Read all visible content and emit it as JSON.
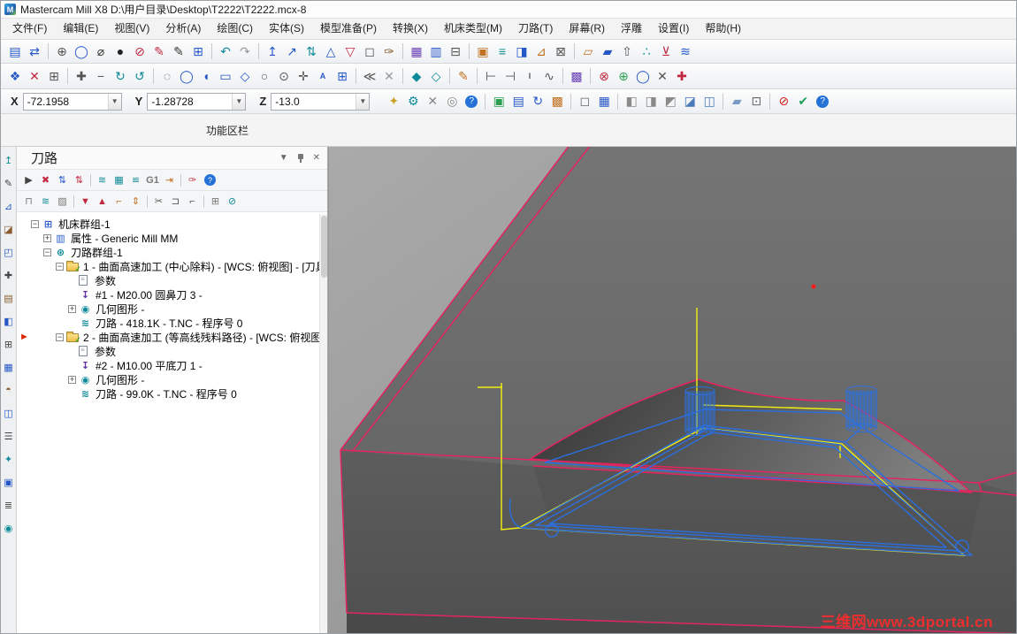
{
  "window": {
    "title": "Mastercam Mill X8  D:\\用户目录\\Desktop\\T2222\\T2222.mcx-8"
  },
  "menu": {
    "items": [
      "文件(F)",
      "编辑(E)",
      "视图(V)",
      "分析(A)",
      "绘图(C)",
      "实体(S)",
      "模型准备(P)",
      "转换(X)",
      "机床类型(M)",
      "刀路(T)",
      "屏幕(R)",
      "浮雕",
      "设置(I)",
      "帮助(H)"
    ]
  },
  "toolbars": {
    "row1": [
      {
        "g": "▤",
        "c": "#2557c7",
        "n": "save-icon"
      },
      {
        "g": "⇄",
        "c": "#2557c7",
        "n": "file-transfer-icon"
      },
      {
        "sep": true
      },
      {
        "g": "⊕",
        "c": "#555555"
      },
      {
        "g": "◯",
        "c": "#2557c7"
      },
      {
        "g": "⌀",
        "c": "#333333"
      },
      {
        "g": "●",
        "c": "#222222"
      },
      {
        "g": "⊘",
        "c": "#c22840"
      },
      {
        "g": "✎",
        "c": "#c22840"
      },
      {
        "g": "✎",
        "c": "#333333"
      },
      {
        "g": "⊞",
        "c": "#2557c7"
      },
      {
        "sep": true
      },
      {
        "g": "↶",
        "c": "#0f8a9a",
        "n": "undo-icon"
      },
      {
        "g": "↷",
        "c": "#999999",
        "n": "redo-icon"
      },
      {
        "sep": true
      },
      {
        "g": "↥",
        "c": "#2557c7"
      },
      {
        "g": "↗",
        "c": "#2557c7"
      },
      {
        "g": "⇅",
        "c": "#0f8a9a"
      },
      {
        "g": "△",
        "c": "#2557c7"
      },
      {
        "g": "▽",
        "c": "#c22840"
      },
      {
        "g": "◻",
        "c": "#555555"
      },
      {
        "g": "✑",
        "c": "#8a5a2b"
      },
      {
        "sep": true
      },
      {
        "g": "▦",
        "c": "#6a3fb5"
      },
      {
        "g": "▥",
        "c": "#2557c7"
      },
      {
        "g": "⊟",
        "c": "#555555"
      },
      {
        "sep": true
      },
      {
        "g": "▣",
        "c": "#c07020"
      },
      {
        "g": "≡",
        "c": "#0f8a9a"
      },
      {
        "g": "◨",
        "c": "#2557c7"
      },
      {
        "g": "⊿",
        "c": "#c07020"
      },
      {
        "g": "⊠",
        "c": "#555555"
      },
      {
        "sep": true
      },
      {
        "g": "▱",
        "c": "#c07020"
      },
      {
        "g": "▰",
        "c": "#2557c7"
      },
      {
        "g": "⇧",
        "c": "#555555"
      },
      {
        "g": "∴",
        "c": "#0f8a9a"
      },
      {
        "g": "⊻",
        "c": "#c22840"
      },
      {
        "g": "≋",
        "c": "#2557c7"
      }
    ],
    "row2": [
      {
        "g": "❖",
        "c": "#2557c7"
      },
      {
        "g": "✕",
        "c": "#c22840"
      },
      {
        "g": "⊞",
        "c": "#555555"
      },
      {
        "sep": true
      },
      {
        "g": "✚",
        "c": "#555555"
      },
      {
        "g": "−",
        "c": "#555555"
      },
      {
        "g": "↻",
        "c": "#0f8a9a"
      },
      {
        "g": "↺",
        "c": "#0f8a9a"
      },
      {
        "sep": true
      },
      {
        "g": "◌",
        "c": "#555555"
      },
      {
        "g": "◯",
        "c": "#2557c7"
      },
      {
        "g": "◖",
        "c": "#2557c7"
      },
      {
        "g": "▭",
        "c": "#2557c7"
      },
      {
        "g": "◇",
        "c": "#2557c7"
      },
      {
        "g": "○",
        "c": "#555555"
      },
      {
        "g": "⊙",
        "c": "#555555"
      },
      {
        "g": "✛",
        "c": "#555555"
      },
      {
        "g": "A",
        "c": "#2557c7",
        "text": true
      },
      {
        "g": "⊞",
        "c": "#2557c7"
      },
      {
        "sep": true
      },
      {
        "g": "≪",
        "c": "#555555"
      },
      {
        "g": "✕",
        "c": "#999999"
      },
      {
        "sep": true
      },
      {
        "g": "◆",
        "c": "#0f8a9a"
      },
      {
        "g": "◇",
        "c": "#0f8a9a"
      },
      {
        "sep": true
      },
      {
        "g": "✎",
        "c": "#c07020"
      },
      {
        "sep": true
      },
      {
        "g": "⊢",
        "c": "#555555"
      },
      {
        "g": "⊣",
        "c": "#555555"
      },
      {
        "g": "I",
        "c": "#555555",
        "text": true
      },
      {
        "g": "∿",
        "c": "#555555"
      },
      {
        "sep": true
      },
      {
        "g": "▩",
        "c": "#6a3fb5"
      },
      {
        "sep": true
      },
      {
        "g": "⊗",
        "c": "#c22840"
      },
      {
        "g": "⊕",
        "c": "#2e9e4f"
      },
      {
        "g": "◯",
        "c": "#2557c7"
      },
      {
        "g": "✕",
        "c": "#555555"
      },
      {
        "g": "✚",
        "c": "#c22840"
      }
    ],
    "row3": [
      {
        "g": "✦",
        "c": "#c9a227"
      },
      {
        "g": "⚙",
        "c": "#0f8a9a",
        "n": "gear-icon"
      },
      {
        "g": "✕",
        "c": "#888888"
      },
      {
        "g": "◎",
        "c": "#888888"
      },
      {
        "help": true,
        "g": "?",
        "n": "help-icon"
      },
      {
        "sep": true
      },
      {
        "g": "▣",
        "c": "#2e9e4f"
      },
      {
        "g": "▤",
        "c": "#2557c7"
      },
      {
        "g": "↻",
        "c": "#2557c7"
      },
      {
        "g": "▩",
        "c": "#c07020"
      },
      {
        "sep": true
      },
      {
        "g": "◻",
        "c": "#666666"
      },
      {
        "g": "▦",
        "c": "#2557c7"
      },
      {
        "sep": true
      },
      {
        "g": "◧",
        "c": "#8a8a8a",
        "n": "shading-cube-icon"
      },
      {
        "g": "◨",
        "c": "#8a8a8a",
        "n": "shading-cube-icon"
      },
      {
        "g": "◩",
        "c": "#8a8a8a",
        "n": "shading-cube-icon"
      },
      {
        "g": "◪",
        "c": "#4a7ab8",
        "n": "shading-cube-icon"
      },
      {
        "g": "◫",
        "c": "#4a7ab8",
        "n": "shading-cube-icon"
      },
      {
        "sep": true
      },
      {
        "g": "▰",
        "c": "#7a9cc4"
      },
      {
        "g": "⊡",
        "c": "#666666"
      },
      {
        "sep": true
      },
      {
        "g": "⊘",
        "c": "#d42020",
        "n": "stop-icon"
      },
      {
        "g": "✔",
        "c": "#1fa05a",
        "n": "check-icon"
      },
      {
        "help": true,
        "g": "?",
        "n": "help-icon"
      }
    ],
    "left_strip": [
      {
        "g": "↥",
        "c": "#0f8a9a"
      },
      {
        "g": "✎",
        "c": "#444444"
      },
      {
        "g": "⊿",
        "c": "#2557c7"
      },
      {
        "g": "◪",
        "c": "#8a5a2b"
      },
      {
        "g": "◰",
        "c": "#2557c7"
      },
      {
        "g": "✚",
        "c": "#444444"
      },
      {
        "g": "▤",
        "c": "#8a5a2b"
      },
      {
        "g": "◧",
        "c": "#2557c7"
      },
      {
        "g": "⊞",
        "c": "#444444"
      },
      {
        "g": "▦",
        "c": "#2557c7"
      },
      {
        "g": "◓",
        "c": "#8a5a2b"
      },
      {
        "g": "◫",
        "c": "#2557c7"
      },
      {
        "g": "☰",
        "c": "#444444"
      },
      {
        "g": "✦",
        "c": "#0f8a9a"
      },
      {
        "g": "▣",
        "c": "#2557c7"
      },
      {
        "g": "≣",
        "c": "#444444"
      },
      {
        "g": "◉",
        "c": "#0f8a9a"
      }
    ]
  },
  "coords": {
    "x_label": "X",
    "x_value": "-72.1958",
    "y_label": "Y",
    "y_value": "-1.28728",
    "z_label": "Z",
    "z_value": "-13.0"
  },
  "ribbon": {
    "label": "功能区栏"
  },
  "panel": {
    "title": "刀路",
    "menu_glyph": "▼",
    "close_glyph": "✕",
    "toolbar1": [
      {
        "g": "▶",
        "c": "#444444",
        "n": "select-all-operations-icon"
      },
      {
        "g": "✖",
        "c": "#c22840",
        "n": "unselect-all-operations-icon"
      },
      {
        "g": "⇅",
        "c": "#2557c7"
      },
      {
        "g": "⇅",
        "c": "#c22840"
      },
      {
        "sep": true
      },
      {
        "g": "≋",
        "c": "#0f8a9a",
        "n": "regenerate-toolpath-icon"
      },
      {
        "g": "▦",
        "c": "#0f8a9a"
      },
      {
        "g": "≌",
        "c": "#0f8a9a"
      },
      {
        "g": "G1",
        "c": "#777777",
        "text": true,
        "n": "post-g1-icon"
      },
      {
        "g": "⇥",
        "c": "#c07020"
      },
      {
        "sep": true
      },
      {
        "g": "✑",
        "c": "#c22840",
        "n": "edit-icon"
      },
      {
        "help": true,
        "g": "?",
        "n": "help-icon"
      }
    ],
    "toolbar2": [
      {
        "g": "⊓",
        "c": "#777777",
        "n": "lock-icon"
      },
      {
        "g": "≋",
        "c": "#0f8a9a"
      },
      {
        "g": "▨",
        "c": "#777777"
      },
      {
        "sep": true
      },
      {
        "g": "▼",
        "c": "#c22840",
        "n": "move-insert-down-icon"
      },
      {
        "g": "▲",
        "c": "#c22840",
        "n": "move-insert-up-icon"
      },
      {
        "g": "⌐",
        "c": "#c07020"
      },
      {
        "g": "⇕",
        "c": "#c07020"
      },
      {
        "sep": true
      },
      {
        "g": "✂",
        "c": "#555555",
        "n": "cut-icon"
      },
      {
        "g": "⊐",
        "c": "#555555",
        "n": "copy-icon"
      },
      {
        "g": "⌐",
        "c": "#555555",
        "n": "paste-icon"
      },
      {
        "sep": true
      },
      {
        "g": "⊞",
        "c": "#777777"
      },
      {
        "g": "⊘",
        "c": "#0f8a9a"
      }
    ],
    "tree": [
      {
        "depth": 0,
        "expander": "minus",
        "icon": "machine-group",
        "glyph": "⊞",
        "label": "机床群组-1"
      },
      {
        "depth": 1,
        "expander": "plus",
        "icon": "properties",
        "glyph": "▥",
        "label": "属性 - Generic Mill MM"
      },
      {
        "depth": 1,
        "expander": "minus",
        "icon": "toolpath-group",
        "glyph": "⊛",
        "label": "刀路群组-1"
      },
      {
        "depth": 2,
        "expander": "minus",
        "icon": "operation-folder",
        "glyph": "",
        "label": "1 - 曲面高速加工 (中心除料) - [WCS: 俯视图] - [刀具"
      },
      {
        "depth": 3,
        "icon": "parameters",
        "glyph": "",
        "label": "参数"
      },
      {
        "depth": 3,
        "icon": "tool",
        "glyph": "↧",
        "label": "#1 - M20.00 圆鼻刀 3 -"
      },
      {
        "depth": 3,
        "expander": "plus",
        "icon": "geometry",
        "glyph": "◉",
        "label": "几何图形 -"
      },
      {
        "depth": 3,
        "icon": "toolpath",
        "glyph": "≋",
        "label": "刀路 - 418.1K - T.NC - 程序号 0"
      },
      {
        "depth": 2,
        "expander": "minus",
        "icon": "operation-folder",
        "glyph": "",
        "label": "2 - 曲面高速加工 (等高线残料路径) - [WCS: 俯视图",
        "marker": true
      },
      {
        "depth": 3,
        "icon": "parameters",
        "glyph": "",
        "label": "参数"
      },
      {
        "depth": 3,
        "icon": "tool",
        "glyph": "↧",
        "label": "#2 - M10.00 平底刀 1 -"
      },
      {
        "depth": 3,
        "expander": "plus",
        "icon": "geometry",
        "glyph": "◉",
        "label": "几何图形 -"
      },
      {
        "depth": 3,
        "icon": "toolpath",
        "glyph": "≋",
        "label": "刀路 - 99.0K - T.NC - 程序号 0"
      }
    ]
  },
  "viewport": {
    "watermark": "三维网www.3dportal.cn",
    "edge_color": "#e4245e",
    "toolpath_blue": "#2a6fe0",
    "toolpath_yellow": "#f2ef10"
  }
}
